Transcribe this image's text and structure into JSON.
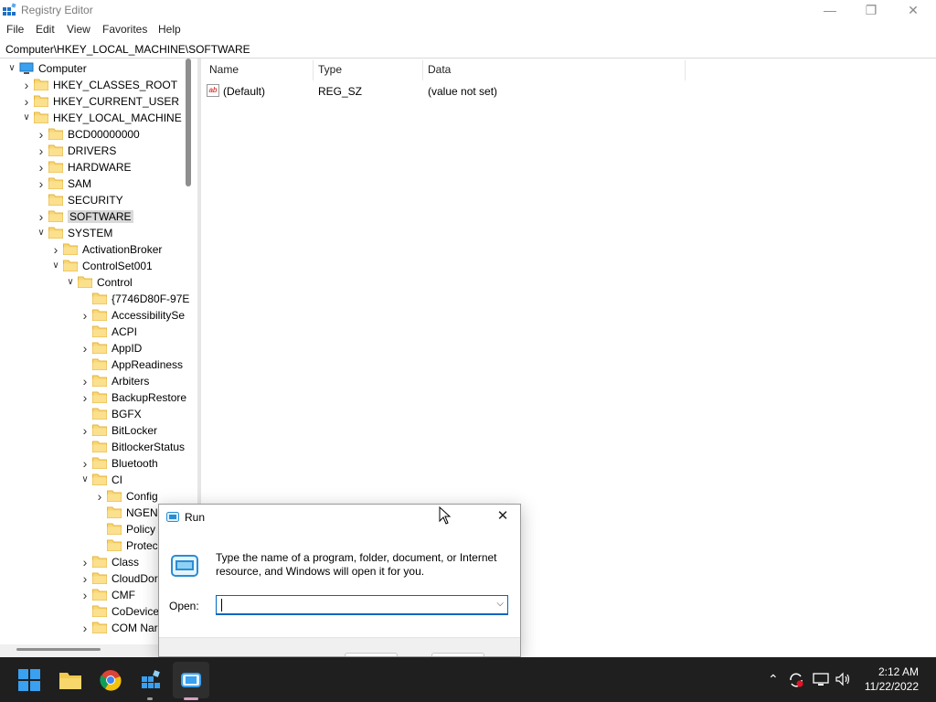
{
  "window": {
    "title": "Registry Editor",
    "minimize": "—",
    "maximize": "❐",
    "close": "✕"
  },
  "menu": [
    "File",
    "Edit",
    "View",
    "Favorites",
    "Help"
  ],
  "address": "Computer\\HKEY_LOCAL_MACHINE\\SOFTWARE",
  "tree": [
    {
      "label": "Computer",
      "chev": "v"
    },
    {
      "label": "HKEY_CLASSES_ROOT",
      "chev": ">"
    },
    {
      "label": "HKEY_CURRENT_USER",
      "chev": ">"
    },
    {
      "label": "HKEY_LOCAL_MACHINE",
      "chev": "v"
    },
    {
      "label": "BCD00000000",
      "chev": ">"
    },
    {
      "label": "DRIVERS",
      "chev": ">"
    },
    {
      "label": "HARDWARE",
      "chev": ">"
    },
    {
      "label": "SAM",
      "chev": ">"
    },
    {
      "label": "SECURITY",
      "chev": ""
    },
    {
      "label": "SOFTWARE",
      "chev": ">",
      "selected": true
    },
    {
      "label": "SYSTEM",
      "chev": "v"
    },
    {
      "label": "ActivationBroker",
      "chev": ">"
    },
    {
      "label": "ControlSet001",
      "chev": "v"
    },
    {
      "label": "Control",
      "chev": "v"
    },
    {
      "label": "{7746D80F-97E",
      "chev": ""
    },
    {
      "label": "AccessibilitySe",
      "chev": ">"
    },
    {
      "label": "ACPI",
      "chev": ""
    },
    {
      "label": "AppID",
      "chev": ">"
    },
    {
      "label": "AppReadiness",
      "chev": ""
    },
    {
      "label": "Arbiters",
      "chev": ">"
    },
    {
      "label": "BackupRestore",
      "chev": ">"
    },
    {
      "label": "BGFX",
      "chev": ""
    },
    {
      "label": "BitLocker",
      "chev": ">"
    },
    {
      "label": "BitlockerStatus",
      "chev": ""
    },
    {
      "label": "Bluetooth",
      "chev": ">"
    },
    {
      "label": "CI",
      "chev": "v"
    },
    {
      "label": "Config",
      "chev": ">"
    },
    {
      "label": "NGEN",
      "chev": ""
    },
    {
      "label": "Policy",
      "chev": ""
    },
    {
      "label": "Protec",
      "chev": ""
    },
    {
      "label": "Class",
      "chev": ">"
    },
    {
      "label": "CloudDor",
      "chev": ">"
    },
    {
      "label": "CMF",
      "chev": ">"
    },
    {
      "label": "CoDevice",
      "chev": ""
    },
    {
      "label": "COM Nar",
      "chev": ">"
    }
  ],
  "list": {
    "columns": [
      "Name",
      "Type",
      "Data"
    ],
    "rows": [
      {
        "name": "(Default)",
        "type": "REG_SZ",
        "data": "(value not set)"
      }
    ]
  },
  "run_dialog": {
    "title": "Run",
    "close": "✕",
    "description": "Type the name of a program, folder, document, or Internet resource, and Windows will open it for you.",
    "open_label": "Open:",
    "open_value": ""
  },
  "taskbar": {
    "apps": [
      "start-icon",
      "file-explorer-icon",
      "chrome-icon",
      "registry-editor-icon",
      "run-icon"
    ],
    "time": "2:12 AM",
    "date": "11/22/2022"
  }
}
